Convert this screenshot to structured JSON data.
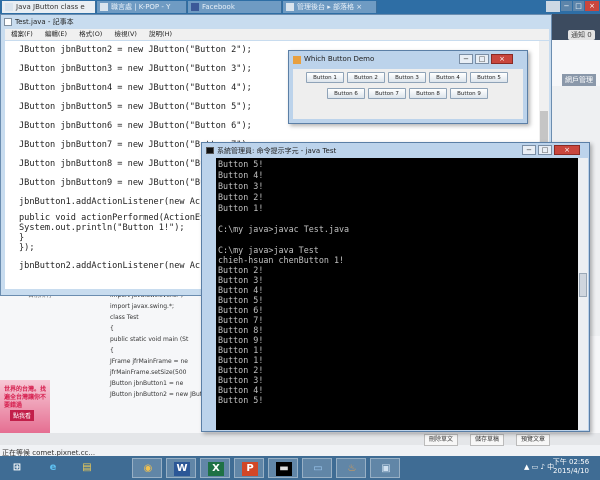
{
  "browser": {
    "tabs": [
      {
        "label": "Java JButton class e"
      },
      {
        "label": "職言處 | K-POP - Y"
      },
      {
        "label": "Facebook"
      },
      {
        "label": "管理後台 ▸ 部落格 ×"
      }
    ],
    "site_logo": "痞",
    "notify_badge": "通知 0",
    "manage_link": "網戶管理",
    "status_text": "正在等候 comet.pixnet.cc...",
    "bottom_buttons": [
      "刪除草文",
      "儲存草稿",
      "預覽文章"
    ],
    "ad_text": "世界的台灣。找遍全台灣讓你不要錯過",
    "ad_button": "點我看",
    "side_text": "目前所有",
    "article_lines": [
      "import java.awt.event.*;",
      "import javax.swing.*;",
      "",
      "class Test",
      "{",
      "public static void main (St",
      "{",
      "",
      "JFrame jfrMainFrame = ne",
      "jfrMainFrame.setSize(500",
      "JButton jbnButton1 = ne",
      "JButton jbnButton2 = new JButton(\"Button 2\");"
    ]
  },
  "notepad": {
    "title": "Test.java - 記事本",
    "menu": [
      "檔案(F)",
      "編輯(E)",
      "格式(O)",
      "檢視(V)",
      "說明(H)"
    ],
    "lines": [
      "JButton jbnButton2 = new JButton(\"Button 2\");",
      "JButton jbnButton3 = new JButton(\"Button 3\");",
      "JButton jbnButton4 = new JButton(\"Button 4\");",
      "JButton jbnButton5 = new JButton(\"Button 5\");",
      "JButton jbnButton6 = new JButton(\"Button 6\");",
      "JButton jbnButton7 = new JButton(\"Button 7\");",
      "JButton jbnButton8 = new JButton(\"Bu",
      "JButton jbnButton9 = new JButton(\"Bu",
      "jbnButton1.addActionListener(new Ac",
      "public void actionPerformed(ActionEv",
      "System.out.println(\"Button 1!\");",
      "}",
      "});",
      "jbnButton2.addActionListener(new Ac"
    ]
  },
  "jframe": {
    "title": "Which Button Demo",
    "buttons": [
      "Button 1",
      "Button 2",
      "Button 3",
      "Button 4",
      "Button 5",
      "Button 6",
      "Button 7",
      "Button 8",
      "Button 9"
    ]
  },
  "console": {
    "title": "系統管理員: 命令提示字元 - java  Test",
    "lines": [
      "Button 5!",
      "Button 4!",
      "Button 3!",
      "Button 2!",
      "Button 1!",
      "",
      "C:\\my java>javac Test.java",
      "",
      "C:\\my java>java Test",
      "chieh-hsuan chenButton 1!",
      "Button 2!",
      "Button 3!",
      "Button 4!",
      "Button 5!",
      "Button 6!",
      "Button 7!",
      "Button 8!",
      "Button 9!",
      "Button 1!",
      "Button 1!",
      "Button 2!",
      "Button 3!",
      "Button 4!",
      "Button 5!"
    ]
  },
  "taskbar": {
    "items": [
      {
        "icon": "ie-icon",
        "glyph": "e"
      },
      {
        "icon": "explorer-icon",
        "glyph": "▤"
      },
      {
        "icon": "chrome-icon",
        "glyph": "◉"
      },
      {
        "icon": "word-icon",
        "glyph": "W"
      },
      {
        "icon": "excel-icon",
        "glyph": "X"
      },
      {
        "icon": "powerpoint-icon",
        "glyph": "P"
      },
      {
        "icon": "cmd-icon",
        "glyph": "▬"
      },
      {
        "icon": "notepad-icon",
        "glyph": "▭"
      },
      {
        "icon": "java-icon",
        "glyph": "♨"
      },
      {
        "icon": "window-icon",
        "glyph": "▣"
      }
    ],
    "time": "下午 02:56",
    "date": "2015/4/10"
  },
  "colors": {
    "taskbar": "#3f6c94",
    "console_bg": "#000000",
    "console_text": "#c0c0c0",
    "window_frame": "#bcd3eb",
    "close_button": "#c9463d"
  }
}
